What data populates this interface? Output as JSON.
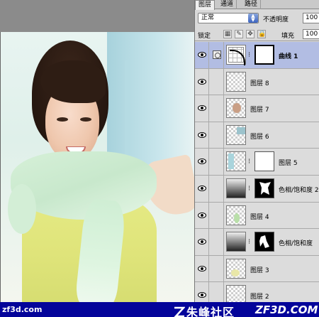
{
  "panel": {
    "tabs": [
      "图层",
      "通道",
      "路径"
    ],
    "blend_mode": "正常",
    "opacity_label": "不透明度",
    "opacity_value": "100",
    "lock_label": "锁定",
    "fill_label": "填充",
    "fill_value": "100",
    "layers": [
      {
        "name": "曲线 1",
        "selected": true
      },
      {
        "name": "图层 8"
      },
      {
        "name": "图层 7"
      },
      {
        "name": "图层 6"
      },
      {
        "name": "图层 5"
      },
      {
        "name": "色相/饱和度 2"
      },
      {
        "name": "图层 4"
      },
      {
        "name": "色相/饱和度"
      },
      {
        "name": "图层 3"
      },
      {
        "name": "图层 2"
      }
    ]
  },
  "watermark": {
    "left": "zf3d.com",
    "middle": "朱峰社区",
    "right": "ZF3D.COM"
  },
  "colors": {
    "watermark_bg": "#04049a",
    "selected_layer": "#b2bde3",
    "panel_bg": "#d9d9d9"
  }
}
